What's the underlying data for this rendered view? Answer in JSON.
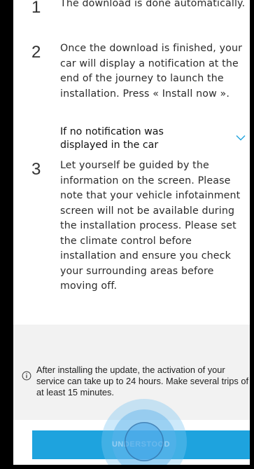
{
  "steps": [
    {
      "number": "1",
      "text": "The download is done automatically."
    },
    {
      "number": "2",
      "text": "Once the download is finished, your car will display a notification at the end of the journey to launch the installation. Press « Install now »."
    },
    {
      "number": "3",
      "text": "Let yourself be guided by the information on the screen. Please note that your vehicle infotainment screen will not be available during the installation process. Please set the climate control before installation and ensure you check your surrounding areas before moving off."
    }
  ],
  "accordion": {
    "title": "If no notification was displayed in the car",
    "expanded": false,
    "icon": "chevron-down-icon",
    "icon_color": "#1ea3de"
  },
  "info": {
    "icon": "info-circle-icon",
    "text": "After installing the update, the activation of your service can take up to 24 hours. Make several trips of at least 15 minutes."
  },
  "actions": {
    "understood_label": "UNDERSTOOD"
  },
  "colors": {
    "accent": "#1ea3de",
    "panel_background": "#f2f2f2",
    "frame": "#000000"
  }
}
